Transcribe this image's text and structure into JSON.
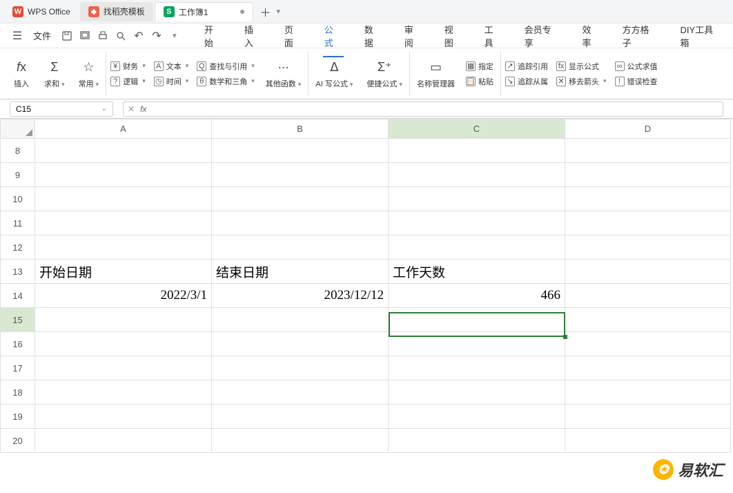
{
  "titlebar": {
    "app_name": "WPS Office",
    "template_tab": "找稻壳模板",
    "doc_tab": "工作簿1"
  },
  "menubar": {
    "file": "文件",
    "tabs": [
      "开始",
      "插入",
      "页面",
      "公式",
      "数据",
      "审阅",
      "视图",
      "工具",
      "会员专享",
      "效率",
      "方方格子",
      "DIY工具箱"
    ],
    "active_index": 3
  },
  "ribbon": {
    "insert": "插入",
    "sum": "求和",
    "common": "常用",
    "finance": "财务",
    "logic": "逻辑",
    "text": "文本",
    "date": "时间",
    "lookup": "查找与引用",
    "math": "数学和三角",
    "other": "其他函数",
    "ai_formula": "AI 写公式",
    "fast_formula": "便捷公式",
    "name_mgr": "名称管理器",
    "assign": "指定",
    "paste": "粘贴",
    "trace_ref": "追踪引用",
    "trace_dep": "追踪从属",
    "show_formula": "显示公式",
    "remove_arrow": "移去箭头",
    "eval": "公式求值",
    "error_check": "错误检查"
  },
  "formula_bar": {
    "cell_ref": "C15",
    "fx": "fx",
    "formula": ""
  },
  "sheet": {
    "cols": [
      "A",
      "B",
      "C",
      "D"
    ],
    "rows": [
      "8",
      "9",
      "10",
      "11",
      "12",
      "13",
      "14",
      "15",
      "16",
      "17",
      "18",
      "19",
      "20"
    ],
    "cells": {
      "r13": {
        "A": "开始日期",
        "B": "结束日期",
        "C": "工作天数"
      },
      "r14": {
        "A": "2022/3/1",
        "B": "2023/12/12",
        "C": "466"
      }
    },
    "selected": {
      "col": "C",
      "row": "15"
    }
  },
  "watermark": "易软汇"
}
